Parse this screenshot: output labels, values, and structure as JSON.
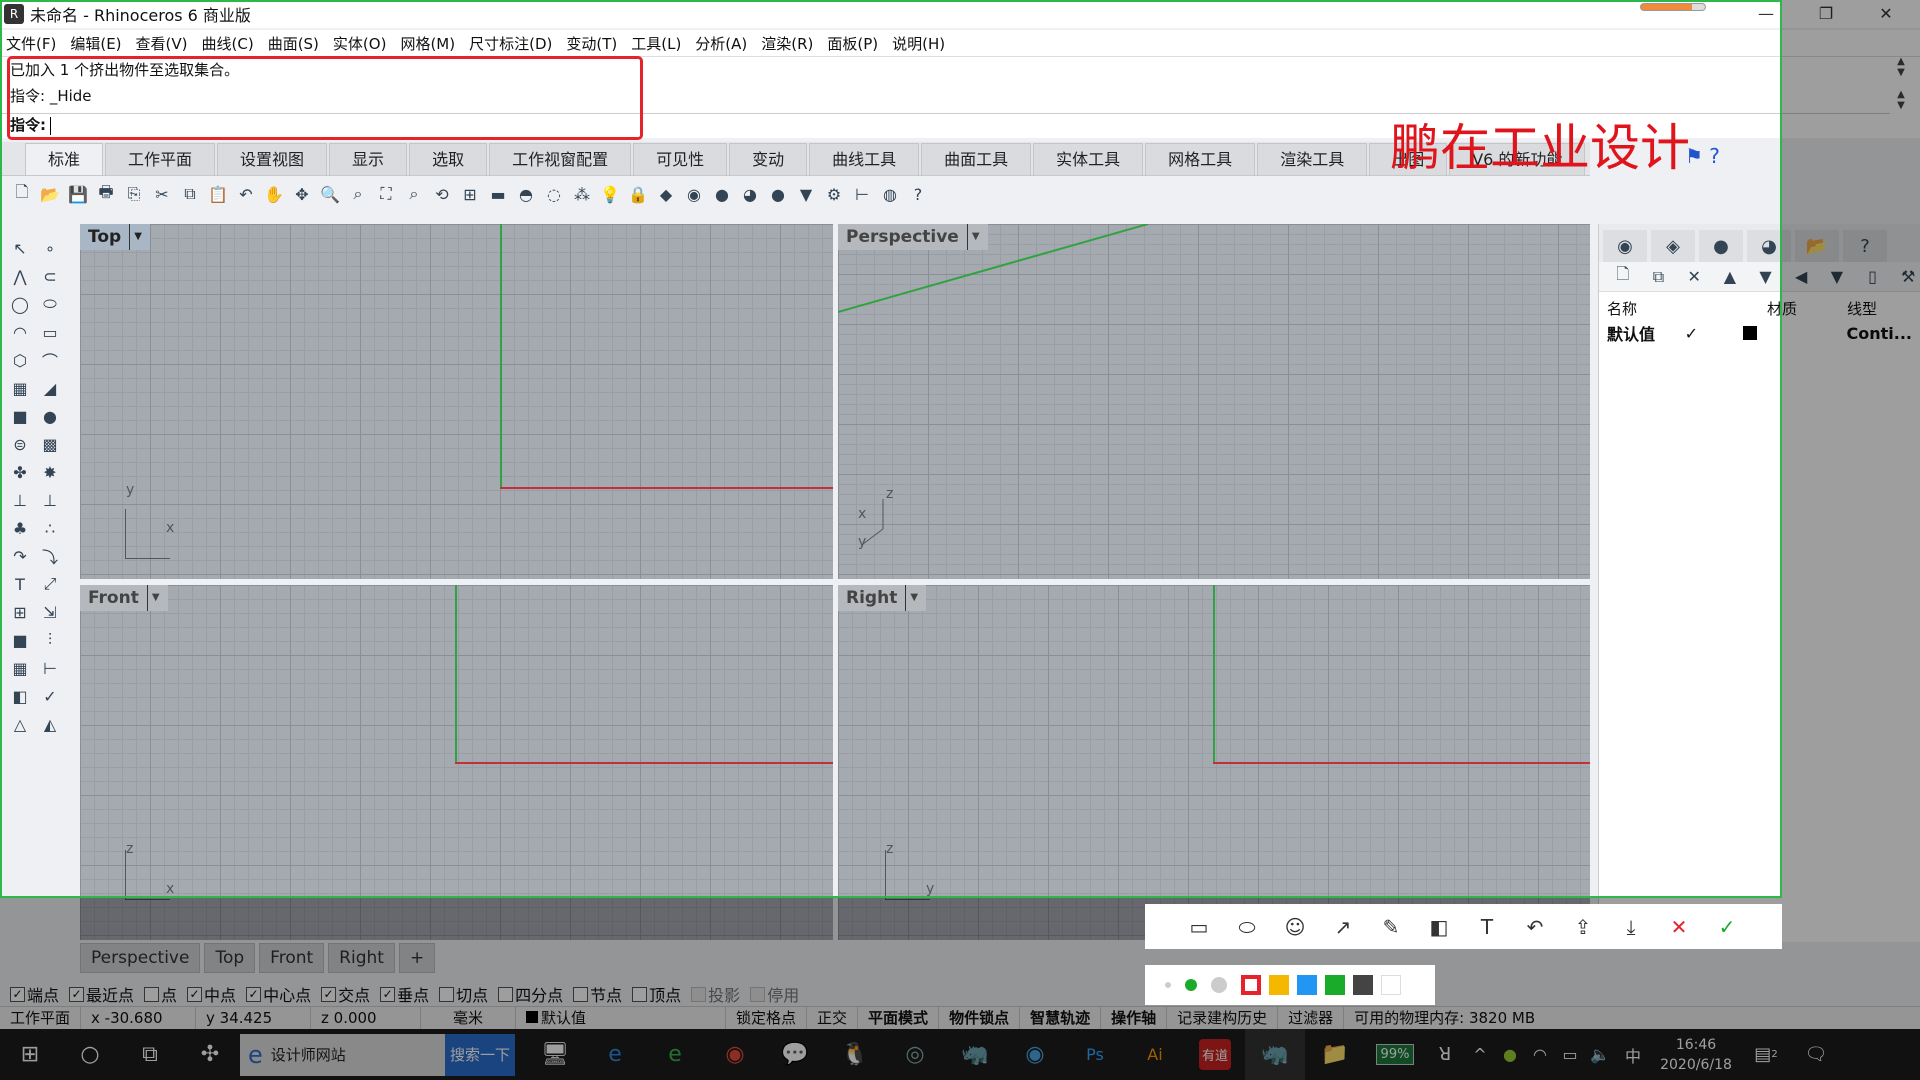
{
  "window": {
    "title": "未命名 - Rhinoceros 6 商业版",
    "minimize": "—",
    "restore": "❐",
    "close": "✕"
  },
  "menu": [
    "文件(F)",
    "编辑(E)",
    "查看(V)",
    "曲线(C)",
    "曲面(S)",
    "实体(O)",
    "网格(M)",
    "尺寸标注(D)",
    "变动(T)",
    "工具(L)",
    "分析(A)",
    "渲染(R)",
    "面板(P)",
    "说明(H)"
  ],
  "command": {
    "history1": "已加入 1 个挤出物件至选取集合。",
    "history2": "指令: _Hide",
    "prompt": "指令:",
    "input": ""
  },
  "watermark": "鹏在工业设计",
  "tabs": [
    "标准",
    "工作平面",
    "设置视图",
    "显示",
    "选取",
    "工作视窗配置",
    "可见性",
    "变动",
    "曲线工具",
    "曲面工具",
    "实体工具",
    "网格工具",
    "渲染工具",
    "出图",
    "V6 的新功能"
  ],
  "active_tab": "标准",
  "toolbar_icons": [
    "new-icon",
    "open-icon",
    "save-icon",
    "print-icon",
    "import-icon",
    "cut-icon",
    "copy-icon",
    "paste-icon",
    "undo-icon",
    "pan-icon",
    "move-view-icon",
    "zoom-in-icon",
    "zoom-window-icon",
    "zoom-extents-icon",
    "zoom-selected-icon",
    "rotate-view-icon",
    "four-view-icon",
    "hide-icon",
    "show-icon",
    "isolate-icon",
    "snap-icon",
    "light-icon",
    "lock-icon",
    "layer-icon",
    "color-wheel-icon",
    "material-icon",
    "render-icon",
    "render-preview-icon",
    "filter-icon",
    "options-gear-icon",
    "dimension-icon",
    "globe-icon",
    "help-icon"
  ],
  "left_tools": [
    "select-icon",
    "point-icon",
    "polyline-icon",
    "curve-icon",
    "circle-icon",
    "ellipse-icon",
    "arc-icon",
    "rectangle-icon",
    "polygon-icon",
    "fillet-curve-icon",
    "surface-points-icon",
    "surface-edge-icon",
    "box-icon",
    "sphere-icon",
    "extrude-icon",
    "surface-patch-icon",
    "boolean-union-icon",
    "explode-icon",
    "split-icon",
    "trim-icon",
    "group-icon",
    "ungroup-icon",
    "offset-icon",
    "offset-curve-icon",
    "text-icon",
    "scale-icon",
    "array-icon",
    "orient-icon",
    "solid-tools-icon",
    "extrude-face-icon",
    "grid-array-icon",
    "dimension-icon",
    "flip-icon",
    "check-icon",
    "mesh-icon",
    "render-tool-icon"
  ],
  "viewports": [
    {
      "name": "Top",
      "active": true,
      "axes": [
        "y",
        "x"
      ]
    },
    {
      "name": "Perspective",
      "active": false,
      "axes": [
        "z",
        "x",
        "y"
      ]
    },
    {
      "name": "Front",
      "active": false,
      "axes": [
        "z",
        "x"
      ]
    },
    {
      "name": "Right",
      "active": false,
      "axes": [
        "z",
        "y"
      ]
    }
  ],
  "viewport_tabs": [
    "Perspective",
    "Top",
    "Front",
    "Right",
    "+"
  ],
  "panel": {
    "tab_icons": [
      "color-wheel-icon",
      "layers-icon",
      "material-icon",
      "render-icon",
      "folder-icon",
      "help-panel-icon"
    ],
    "tool_icons": [
      "new-layer-icon",
      "copy-layer-icon",
      "delete-icon",
      "move-up-icon",
      "move-down-icon",
      "left-icon",
      "filter-icon",
      "page-icon",
      "tools-icon"
    ],
    "columns": [
      "名称",
      "材质",
      "线型"
    ],
    "layer": {
      "name": "默认值",
      "current": "✓",
      "linetype": "Conti..."
    }
  },
  "osnaps": [
    {
      "label": "端点",
      "checked": true
    },
    {
      "label": "最近点",
      "checked": true
    },
    {
      "label": "点",
      "checked": false
    },
    {
      "label": "中点",
      "checked": true
    },
    {
      "label": "中心点",
      "checked": true
    },
    {
      "label": "交点",
      "checked": true
    },
    {
      "label": "垂点",
      "checked": true
    },
    {
      "label": "切点",
      "checked": false
    },
    {
      "label": "四分点",
      "checked": false
    },
    {
      "label": "节点",
      "checked": false
    },
    {
      "label": "顶点",
      "checked": false
    },
    {
      "label": "投影",
      "checked": false,
      "disabled": true
    },
    {
      "label": "停用",
      "checked": false,
      "disabled": true
    }
  ],
  "status": {
    "cplane": "工作平面",
    "x": "x -30.680",
    "y": "y 34.425",
    "z": "z 0.000",
    "units": "毫米",
    "layer": "默认值",
    "items": [
      "锁定格点",
      "正交",
      "平面模式",
      "物件锁点",
      "智慧轨迹",
      "操作轴",
      "记录建构历史",
      "过滤器"
    ],
    "bold": [
      false,
      false,
      true,
      true,
      true,
      true,
      false,
      false
    ],
    "memory": "可用的物理内存: 3820 MB"
  },
  "taskbar": {
    "search_text": "设计师网站",
    "search_button": "搜索一下",
    "battery": "99%",
    "time": "16:46",
    "date": "2020/6/18",
    "notifications": "2",
    "ime": "中"
  },
  "annotation_tools": [
    "rectangle-icon",
    "ellipse-icon",
    "emoji-icon",
    "arrow-icon",
    "pen-icon",
    "mosaic-icon",
    "text-icon",
    "undo-icon",
    "share-icon",
    "download-icon",
    "cancel-icon",
    "confirm-icon"
  ],
  "palette": {
    "sizes": [
      "small",
      "medium",
      "large"
    ],
    "colors": [
      "#e8222a",
      "#f5b800",
      "#2196f3",
      "#1aab2b",
      "#444444",
      "#ffffff"
    ],
    "selected": "#e8222a"
  },
  "colors": {
    "accent_green": "#2fb84a",
    "red_highlight": "#e8222a",
    "viewport_bg": "#a5a9b0"
  }
}
